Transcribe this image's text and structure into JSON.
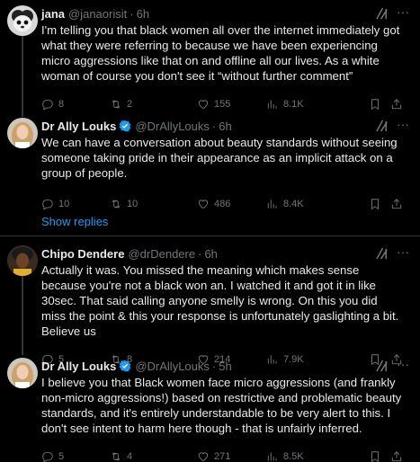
{
  "tweets": [
    {
      "name": "jana",
      "handle": "@janaorisit",
      "time": "6h",
      "verified": false,
      "text": "I'm telling you that black women all over the internet immediately got what they were referring to because we have been experiencing micro aggressions like that on and offline all our lives. As a white woman of course you don't see it “without further comment”",
      "replies": "8",
      "retweets": "2",
      "likes": "155",
      "views": "8.1K"
    },
    {
      "name": "Dr Ally Louks",
      "handle": "@DrAllyLouks",
      "time": "6h",
      "verified": true,
      "text": "We can have a conversation about beauty standards without seeing someone taking pride in their appearance as an implicit attack on a group of people.",
      "replies": "10",
      "retweets": "10",
      "likes": "486",
      "views": "8.4K"
    },
    {
      "name": "Chipo Dendere",
      "handle": "@drDendere",
      "time": "6h",
      "verified": false,
      "text": "Actually it was. You missed the meaning which makes sense because you're not a black won an. I watched it and got it in like 30sec. That said calling anyone smelly is wrong. On this you did miss the point & this your response is unfortunately gaslighting a bit. Believe us",
      "replies": "5",
      "retweets": "8",
      "likes": "214",
      "views": "7.9K"
    },
    {
      "name": "Dr Ally Louks",
      "handle": "@DrAllyLouks",
      "time": "5h",
      "verified": true,
      "text": "I believe you that Black women face micro aggressions (and frankly non-micro aggressions!) based on restrictive and problematic beauty standards, and it's entirely understandable to be very alert to this. I don't see intent to harm here though - that is unfairly inferred.",
      "replies": "5",
      "retweets": "4",
      "likes": "271",
      "views": "8.5K"
    }
  ],
  "show_replies": "Show replies",
  "dot": "·",
  "more": "···",
  "colors": {
    "accent": "#1d9bf0",
    "muted": "#71767b",
    "text": "#e7e9ea",
    "background": "#000000"
  }
}
